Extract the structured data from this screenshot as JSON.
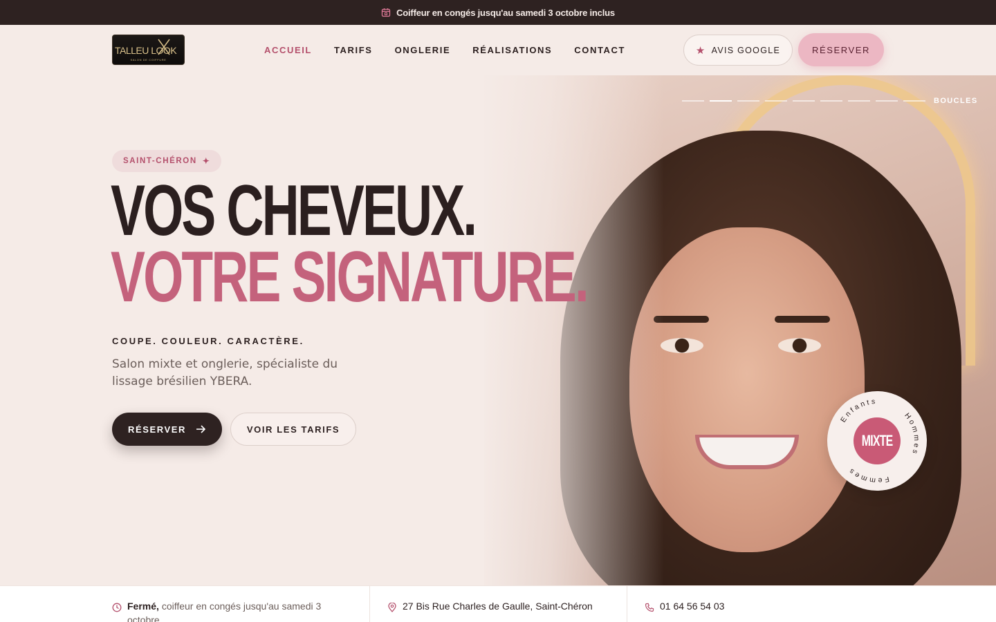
{
  "topbar": {
    "message": "Coiffeur en congés jusqu'au samedi 3 octobre inclus",
    "icon": "calendar-icon"
  },
  "header": {
    "logo_text": "TALLEU LOOK",
    "logo_sub": "SALON DE COIFFURE",
    "nav": [
      {
        "label": "ACCUEIL",
        "active": true
      },
      {
        "label": "TARIFS",
        "active": false
      },
      {
        "label": "ONGLERIE",
        "active": false
      },
      {
        "label": "RÉALISATIONS",
        "active": false
      },
      {
        "label": "CONTACT",
        "active": false
      }
    ],
    "google_button": "AVIS GOOGLE",
    "reserve_button": "RÉSERVER"
  },
  "hero": {
    "slide_label": "BOUCLES",
    "slide_count": 9,
    "active_slide": 2,
    "chip": "SAINT-CHÉRON",
    "title_line1": "VOS CHEVEUX.",
    "title_line2": "VOTRE SIGNATURE.",
    "tagline": "COUPE. COULEUR. CARACTÈRE.",
    "description": "Salon mixte et onglerie, spécialiste du lissage brésilien YBERA.",
    "cta_primary": "RÉSERVER",
    "cta_secondary": "VOIR LES TARIFS",
    "badge_center": "MIXTE",
    "badge_ring": [
      "Enfants",
      "Hommes",
      "Femmes"
    ]
  },
  "infobar": {
    "hours_status": "Fermé,",
    "hours_detail": "coiffeur en congés jusqu'au samedi 3 octobre",
    "address": "27 Bis Rue Charles de Gaulle, Saint-Chéron",
    "phone": "01 64 56 54 03"
  },
  "colors": {
    "accent": "#c4627c",
    "dark": "#2e2221",
    "background": "#f5ebe7",
    "pink_button": "#ecb7c3"
  }
}
